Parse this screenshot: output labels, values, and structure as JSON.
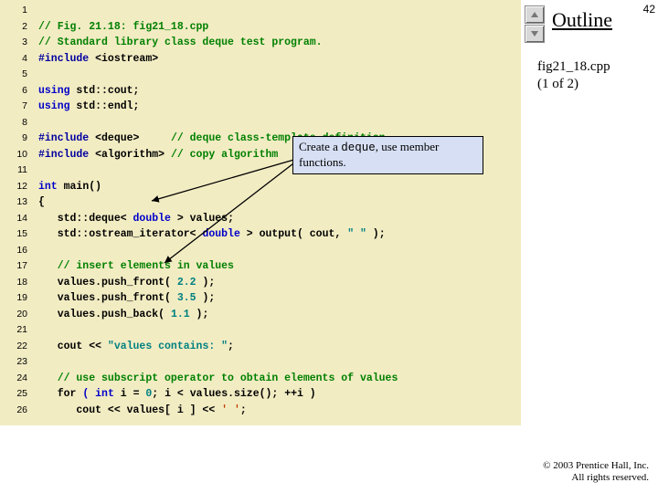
{
  "slide_number": "42",
  "outline_label": "Outline",
  "file_label_line1": "fig21_18.cpp",
  "file_label_line2": "(1 of 2)",
  "copyright_line1": "© 2003 Prentice Hall, Inc.",
  "copyright_line2": "All rights reserved.",
  "callout_pre": "Create a ",
  "callout_code": "deque",
  "callout_post": ", use member functions.",
  "gutter": [
    "1",
    "2",
    "3",
    "4",
    "5",
    "6",
    "7",
    "8",
    "9",
    "10",
    "11",
    "12",
    "13",
    "14",
    "15",
    "16",
    "17",
    "18",
    "19",
    "20",
    "21",
    "22",
    "23",
    "24",
    "25",
    "26"
  ],
  "code": {
    "l1": "// Fig. 21.18: fig21_18.cpp",
    "l2": "// Standard library class deque test program.",
    "l3a": "#include ",
    "l3b": "<iostream>",
    "l5a": "using",
    "l5b": " std::cout;",
    "l6a": "using",
    "l6b": " std::endl;",
    "l8a": "#include ",
    "l8b": "<deque>",
    "l8c": "     // deque class-template definition",
    "l9a": "#include ",
    "l9b": "<algorithm>",
    "l9c": " // copy algorithm",
    "l11a": "int",
    "l11b": " main()",
    "l12": "{",
    "l13a": "   std::deque< ",
    "l13b": "double",
    "l13c": " > values;",
    "l14a": "   std::ostream_iterator< ",
    "l14b": "double",
    "l14c": " > output( cout, ",
    "l14d": "\" \"",
    "l14e": " );",
    "l16": "   // insert elements in values",
    "l17a": "   values.push_front( ",
    "l17b": "2.2",
    "l17c": " );",
    "l18a": "   values.push_front( ",
    "l18b": "3.5",
    "l18c": " );",
    "l19a": "   values.push_back( ",
    "l19b": "1.1",
    "l19c": " );",
    "l21a": "   cout << ",
    "l21b": "\"values contains: \"",
    "l21c": ";",
    "l23": "   // use subscript operator to obtain elements of values",
    "l24a": "   for",
    "l24b": " ( ",
    "l24c": "int",
    "l24d": " i = ",
    "l24e": "0",
    "l24f": "; i < values.size(); ++i )",
    "l25a": "      cout << values[ i ] << ",
    "l25b": "' '",
    "l25c": ";"
  }
}
